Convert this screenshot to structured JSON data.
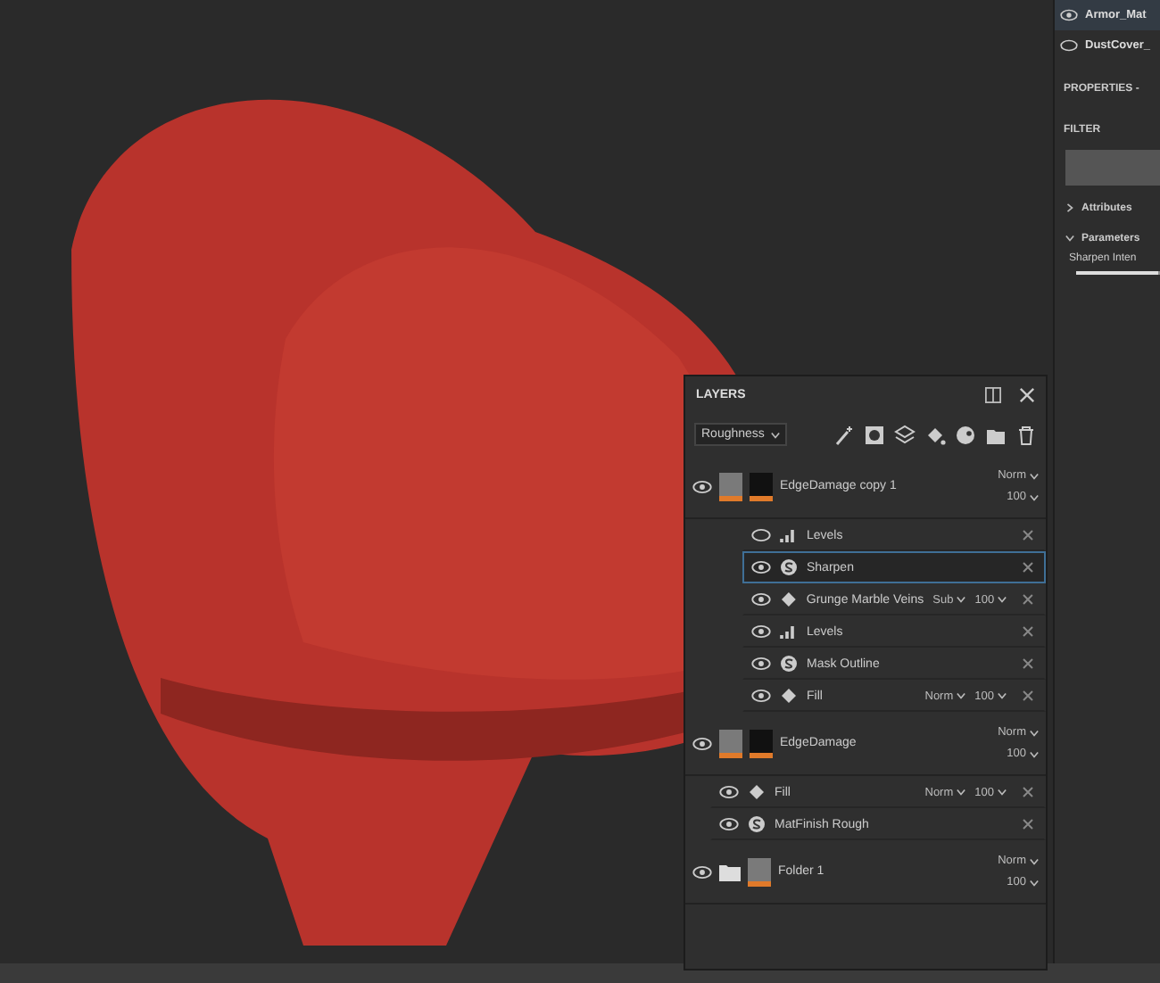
{
  "materials": [
    {
      "name": "Armor_Mat",
      "visible": true,
      "selected": true
    },
    {
      "name": "DustCover_",
      "visible": false,
      "selected": false
    }
  ],
  "properties": {
    "title": "PROPERTIES -",
    "section": "FILTER",
    "groups": [
      {
        "label": "Attributes",
        "expanded": false
      },
      {
        "label": "Parameters",
        "expanded": true
      }
    ],
    "param_label": "Sharpen Inten",
    "level": 0.97
  },
  "layers_panel": {
    "title": "LAYERS",
    "channel": "Roughness",
    "items": [
      {
        "kind": "layer",
        "name": "EdgeDamage copy 1",
        "visible": true,
        "blend": "Norm",
        "opacity": "100",
        "children": [
          {
            "kind": "levels",
            "name": "Levels",
            "visible": false,
            "selected": false
          },
          {
            "kind": "filter",
            "name": "Sharpen",
            "visible": true,
            "selected": true
          },
          {
            "kind": "fill",
            "name": "Grunge Marble Veins",
            "visible": true,
            "selected": false,
            "blend": "Sub",
            "opacity": "100"
          },
          {
            "kind": "levels",
            "name": "Levels",
            "visible": true,
            "selected": false
          },
          {
            "kind": "filter",
            "name": "Mask Outline",
            "visible": true,
            "selected": false
          },
          {
            "kind": "fill",
            "name": "Fill",
            "visible": true,
            "selected": false,
            "blend": "Norm",
            "opacity": "100"
          }
        ]
      },
      {
        "kind": "layer",
        "name": "EdgeDamage",
        "visible": true,
        "blend": "Norm",
        "opacity": "100"
      },
      {
        "kind": "fill",
        "name": "Fill",
        "visible": true,
        "selected": false,
        "blend": "Norm",
        "opacity": "100"
      },
      {
        "kind": "filter",
        "name": "MatFinish Rough",
        "visible": true,
        "selected": false
      },
      {
        "kind": "folder",
        "name": "Folder 1",
        "visible": true,
        "blend": "Norm",
        "opacity": "100"
      }
    ]
  }
}
